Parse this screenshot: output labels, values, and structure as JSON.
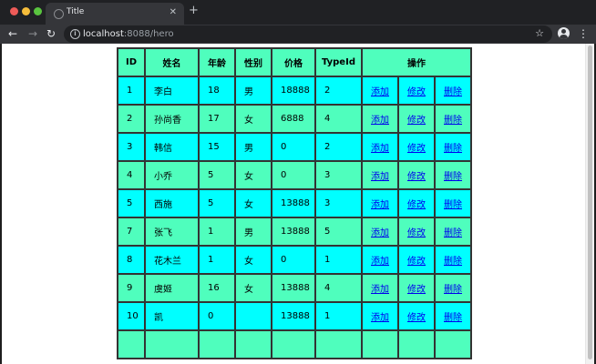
{
  "browser": {
    "tab_title": "Title",
    "tab_close": "✕",
    "new_tab": "+",
    "url_host": "localhost",
    "url_path": ":8088/hero",
    "back_icon": "←",
    "forward_icon": "→",
    "reload_icon": "↻",
    "star_icon": "☆",
    "menu_icon": "⋮",
    "info_icon": "i"
  },
  "table": {
    "headers": {
      "id": "ID",
      "name": "姓名",
      "age": "年龄",
      "gender": "性别",
      "price": "价格",
      "typeid": "TypeId",
      "ops": "操作"
    },
    "rows": [
      {
        "id": "1",
        "name": "李白",
        "age": "18",
        "gender": "男",
        "price": "18888",
        "typeid": "2"
      },
      {
        "id": "2",
        "name": "孙尚香",
        "age": "17",
        "gender": "女",
        "price": "6888",
        "typeid": "4"
      },
      {
        "id": "3",
        "name": "韩信",
        "age": "15",
        "gender": "男",
        "price": "0",
        "typeid": "2"
      },
      {
        "id": "4",
        "name": "小乔",
        "age": "5",
        "gender": "女",
        "price": "0",
        "typeid": "3"
      },
      {
        "id": "5",
        "name": "西施",
        "age": "5",
        "gender": "女",
        "price": "13888",
        "typeid": "3"
      },
      {
        "id": "7",
        "name": "张飞",
        "age": "1",
        "gender": "男",
        "price": "13888",
        "typeid": "5"
      },
      {
        "id": "8",
        "name": "花木兰",
        "age": "1",
        "gender": "女",
        "price": "0",
        "typeid": "1"
      },
      {
        "id": "9",
        "name": "虞姬",
        "age": "16",
        "gender": "女",
        "price": "13888",
        "typeid": "4"
      },
      {
        "id": "10",
        "name": "凯",
        "age": "0",
        "gender": "",
        "price": "13888",
        "typeid": "1"
      },
      {
        "id": "",
        "name": "",
        "age": "",
        "gender": "",
        "price": "",
        "typeid": ""
      }
    ],
    "actions": {
      "add": "添加",
      "edit": "修改",
      "delete": "删除"
    }
  },
  "colors": {
    "row_even": "#4ffebd",
    "row_odd": "#00ffff"
  }
}
